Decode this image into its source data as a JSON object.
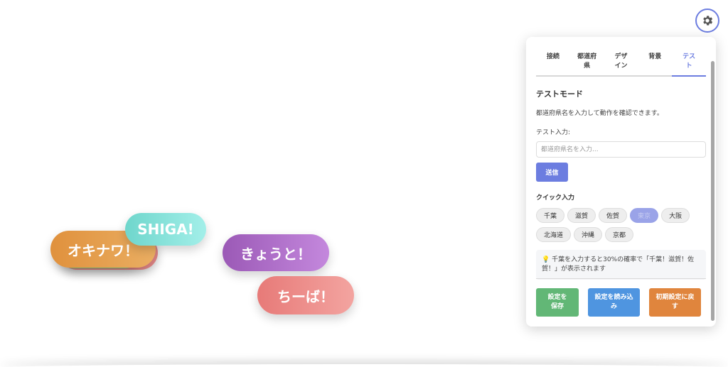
{
  "bubbles": {
    "okinawa": "オキナワ！",
    "shiga": "SHIGA!",
    "kyoto": "きょうと！",
    "chiba": "ちーば！"
  },
  "settings_button": {
    "icon": "gear-icon"
  },
  "panel": {
    "tabs": [
      {
        "label": "接続",
        "active": false
      },
      {
        "label": "都道府県",
        "active": false
      },
      {
        "label": "デザイン",
        "active": false
      },
      {
        "label": "背景",
        "active": false
      },
      {
        "label": "テスト",
        "active": true
      }
    ],
    "title": "テストモード",
    "description": "都道府県名を入力して動作を確認できます。",
    "input_label": "テスト入力:",
    "input_placeholder": "都道府県名を入力...",
    "send_label": "送信",
    "quick_title": "クイック入力",
    "quick_items": [
      {
        "label": "千葉",
        "selected": false
      },
      {
        "label": "滋賀",
        "selected": false
      },
      {
        "label": "佐賀",
        "selected": false
      },
      {
        "label": "東京",
        "selected": true
      },
      {
        "label": "大阪",
        "selected": false
      },
      {
        "label": "北海道",
        "selected": false
      },
      {
        "label": "沖縄",
        "selected": false
      },
      {
        "label": "京都",
        "selected": false
      }
    ],
    "info_icon": "lightbulb-icon",
    "info_text": "千葉を入力すると30%の確率で「千葉！滋賀！佐賀！」が表示されます",
    "actions": {
      "save": "設定を保存",
      "load": "設定を読み込み",
      "reset": "初期設定に戻す"
    }
  }
}
